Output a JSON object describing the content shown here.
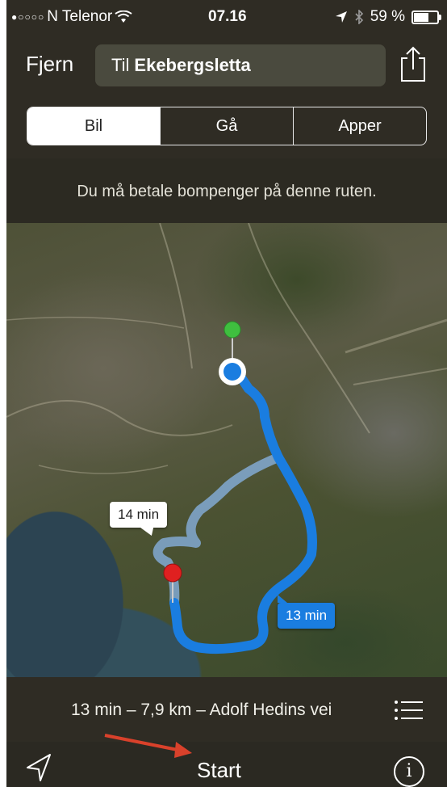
{
  "status": {
    "signal": "●○○○○",
    "carrier": "N Telenor",
    "wifi_icon": "wifi-icon",
    "time": "07.16",
    "battery": "59 %",
    "battery_level": 0.59
  },
  "header": {
    "cancel_label": "Fjern",
    "destination_prefix": "Til",
    "destination_name": "Ekebergsletta",
    "share_icon": "share-icon"
  },
  "modes": {
    "items": [
      {
        "label": "Bil",
        "selected": true
      },
      {
        "label": "Gå",
        "selected": false
      },
      {
        "label": "Apper",
        "selected": false
      }
    ]
  },
  "notice": "Du må betale bompenger på denne ruten.",
  "map": {
    "alt_route_time": "14 min",
    "main_route_time": "13 min",
    "route_color": "#1a7de0",
    "alt_route_color": "#8ab6e8",
    "start_pin_color": "#3fbf3f",
    "end_pin_color": "#e02020"
  },
  "summary": {
    "text": "13 min – 7,9 km – Adolf Hedins vei"
  },
  "toolbar": {
    "start_label": "Start",
    "info_label": "i"
  },
  "colors": {
    "annotation_arrow": "#d9412b"
  }
}
